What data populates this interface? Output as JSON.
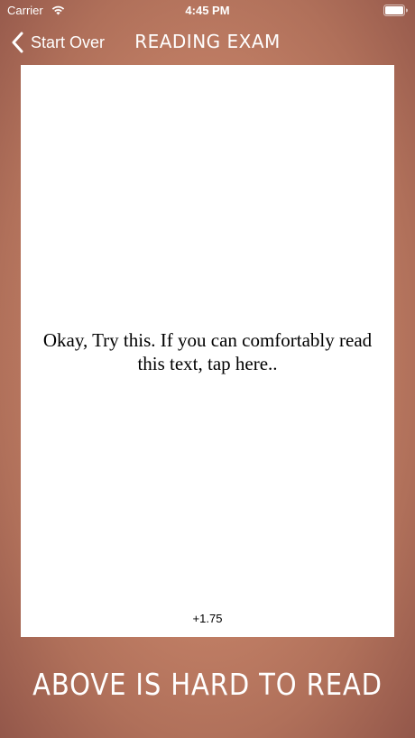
{
  "status_bar": {
    "carrier": "Carrier",
    "time": "4:45 PM",
    "wifi_icon": "wifi-icon",
    "battery_icon": "battery-icon"
  },
  "nav": {
    "back_label": "Start Over",
    "back_icon": "chevron-left-icon",
    "title": "READING EXAM"
  },
  "card": {
    "text": "Okay, Try this. If you can comfortably read this text, tap here..",
    "power": "+1.75"
  },
  "bottom_button": {
    "label": "ABOVE IS HARD TO READ"
  },
  "colors": {
    "background": "#c8856a",
    "card": "#ffffff",
    "text_on_background": "#ffffff"
  }
}
